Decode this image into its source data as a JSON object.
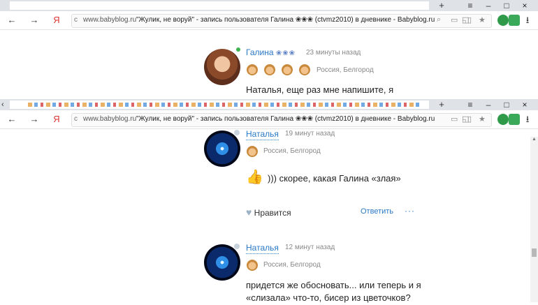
{
  "browser": {
    "tab_close": "×",
    "new_tab": "+",
    "menu_icon": "≡",
    "minimize": "–",
    "maximize": "□",
    "close": "×",
    "back": "←",
    "forward": "→",
    "yandex": "Я",
    "address_lock": "c",
    "domain": "www.babyblog.ru",
    "page_title_1": "\"Жулик, не воруй\" - запись пользователя Галина ❀❀❀ (ctvmz2010) в дневнике - Babyblog.ru",
    "page_title_2": "\"Жулик, не воруй\" - запись пользователя Галина ❀❀❀ (ctvmz2010) в дневнике - Babyblog.ru",
    "star_icon": "★",
    "download_icon": "⭳"
  },
  "posts": [
    {
      "author": "Галина",
      "stars": "❀❀❀",
      "time": "23 минуты назад",
      "location": "Россия, Белгород",
      "text": "Наталья, еще раз мне напишите, я"
    },
    {
      "author": "Наталья",
      "time": "19 минут назад",
      "location": "Россия, Белгород",
      "text": "))) скорее, какая Галина «злая»",
      "like_label": "Нравится",
      "reply_label": "Ответить",
      "more_label": "···"
    },
    {
      "author": "Наталья",
      "time": "12 минут назад",
      "location": "Россия, Белгород",
      "text_line1": "придется же обосновать... или теперь и я",
      "text_line2": "«слизала» что-то, бисер из цветочков?"
    }
  ],
  "colors": {
    "link": "#2a79c6",
    "online": "#3fb34f",
    "tabstrip": "#dfe3e8"
  }
}
